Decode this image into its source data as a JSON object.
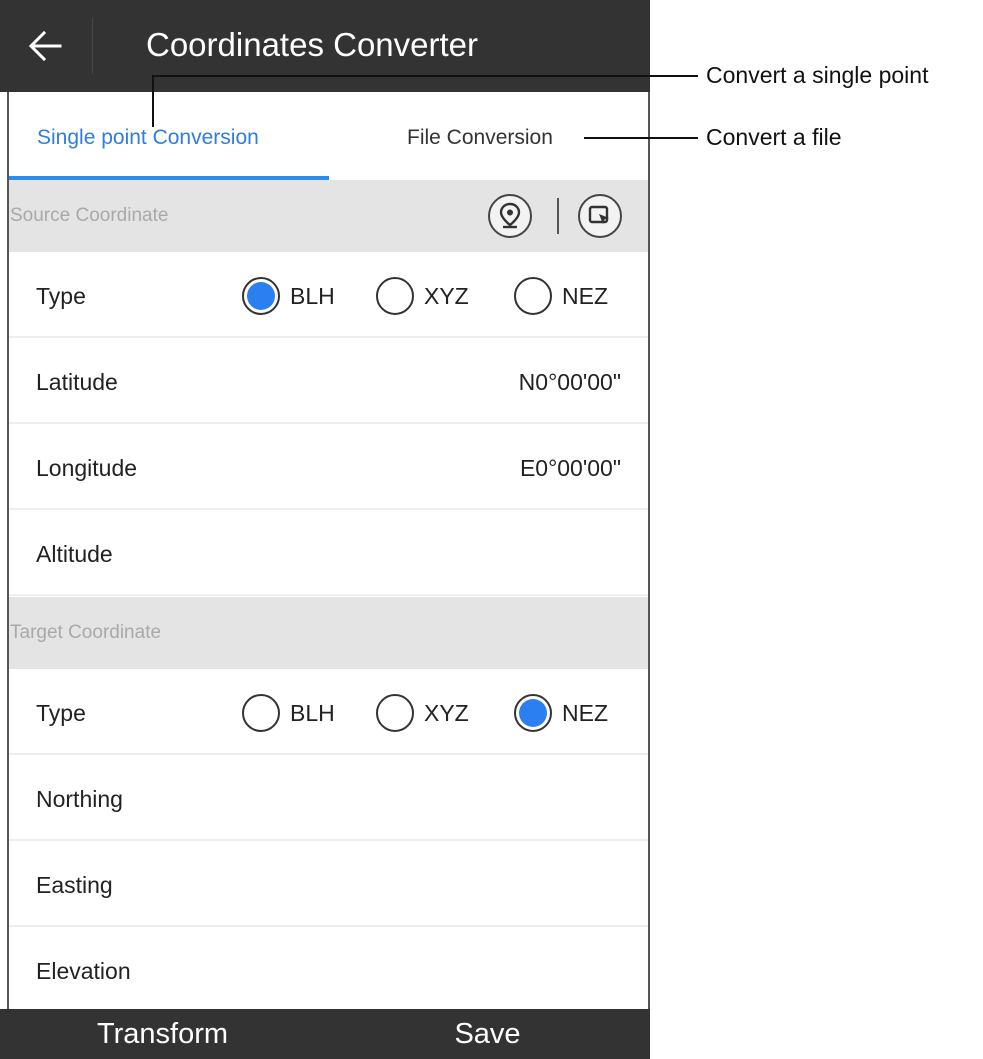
{
  "app": {
    "title": "Coordinates Converter",
    "back_icon": "arrow-left-icon"
  },
  "tabs": [
    {
      "label": "Single point Conversion",
      "active": true
    },
    {
      "label": "File Conversion",
      "active": false
    }
  ],
  "source": {
    "section_label": "Source Coordinate",
    "icons": [
      "location-pin-icon",
      "map-select-icon"
    ],
    "type_label": "Type",
    "type_options": [
      {
        "label": "BLH",
        "checked": true
      },
      {
        "label": "XYZ",
        "checked": false
      },
      {
        "label": "NEZ",
        "checked": false
      }
    ],
    "latitude": {
      "label": "Latitude",
      "value": "N0°00'00\""
    },
    "longitude": {
      "label": "Longitude",
      "value": "E0°00'00\""
    },
    "altitude": {
      "label": "Altitude",
      "value": ""
    }
  },
  "target": {
    "section_label": "Target Coordinate",
    "type_label": "Type",
    "type_options": [
      {
        "label": "BLH",
        "checked": false
      },
      {
        "label": "XYZ",
        "checked": false
      },
      {
        "label": "NEZ",
        "checked": true
      }
    ],
    "northing": {
      "label": "Northing",
      "value": ""
    },
    "easting": {
      "label": "Easting",
      "value": ""
    },
    "elevation": {
      "label": "Elevation",
      "value": ""
    }
  },
  "bottom_bar": {
    "transform_label": "Transform",
    "save_label": "Save"
  },
  "callouts": {
    "single_point": "Convert a single point",
    "file": "Convert a file"
  },
  "colors": {
    "accent": "#2c7ff0",
    "bar_background": "#333333",
    "section_background": "#e4e4e4"
  }
}
